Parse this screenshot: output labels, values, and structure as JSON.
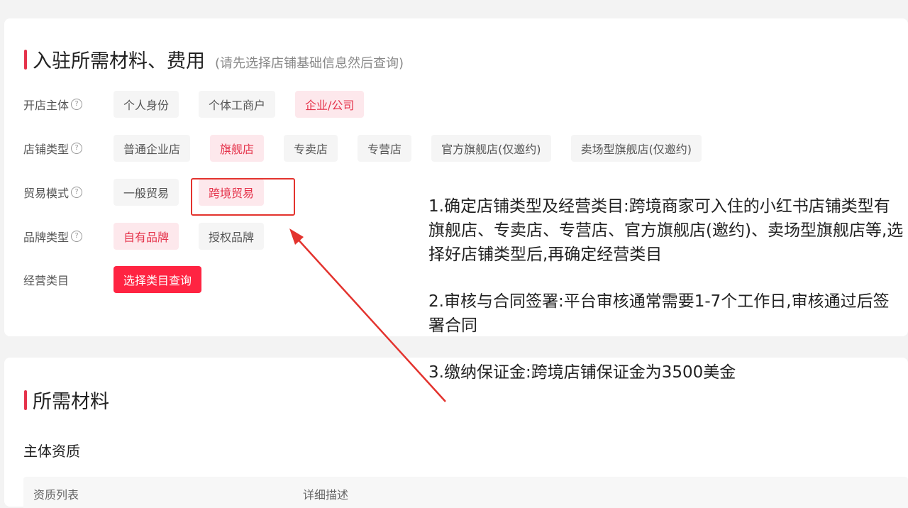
{
  "section1": {
    "title": "入驻所需材料、费用",
    "hint": "(请先选择店铺基础信息然后查询)"
  },
  "rows": [
    {
      "label": "开店主体",
      "help": "?",
      "options": [
        "个人身份",
        "个体工商户",
        "企业/公司"
      ],
      "selected": "企业/公司"
    },
    {
      "label": "店铺类型",
      "help": "?",
      "options": [
        "普通企业店",
        "旗舰店",
        "专卖店",
        "专营店",
        "官方旗舰店(仅邀约)",
        "卖场型旗舰店(仅邀约)"
      ],
      "selected": "旗舰店"
    },
    {
      "label": "贸易模式",
      "help": "?",
      "options": [
        "一般贸易",
        "跨境贸易"
      ],
      "selected": "跨境贸易"
    },
    {
      "label": "品牌类型",
      "help": "?",
      "options": [
        "自有品牌",
        "授权品牌"
      ],
      "selected": "自有品牌"
    },
    {
      "label": "经营类目",
      "button": "选择类目查询"
    }
  ],
  "annotation": [
    "1.确定店铺类型及经营类目:跨境商家可入住的小红书店铺类型有旗舰店、专卖店、专营店、官方旗舰店(邀约)、卖场型旗舰店等,选择好店铺类型后,再确定经营类目",
    "2.审核与合同签署:平台审核通常需要1-7个工作日,审核通过后签署合同",
    "3.缴纳保证金:跨境店铺保证金为3500美金"
  ],
  "section2": {
    "title": "所需材料",
    "subtitle": "主体资质",
    "columns": [
      "资质列表",
      "详细描述"
    ]
  },
  "colors": {
    "accent": "#ff2442",
    "selected_bg": "#fde8ec",
    "selected_text": "#e5334b",
    "annotation_red": "#e3332e"
  }
}
